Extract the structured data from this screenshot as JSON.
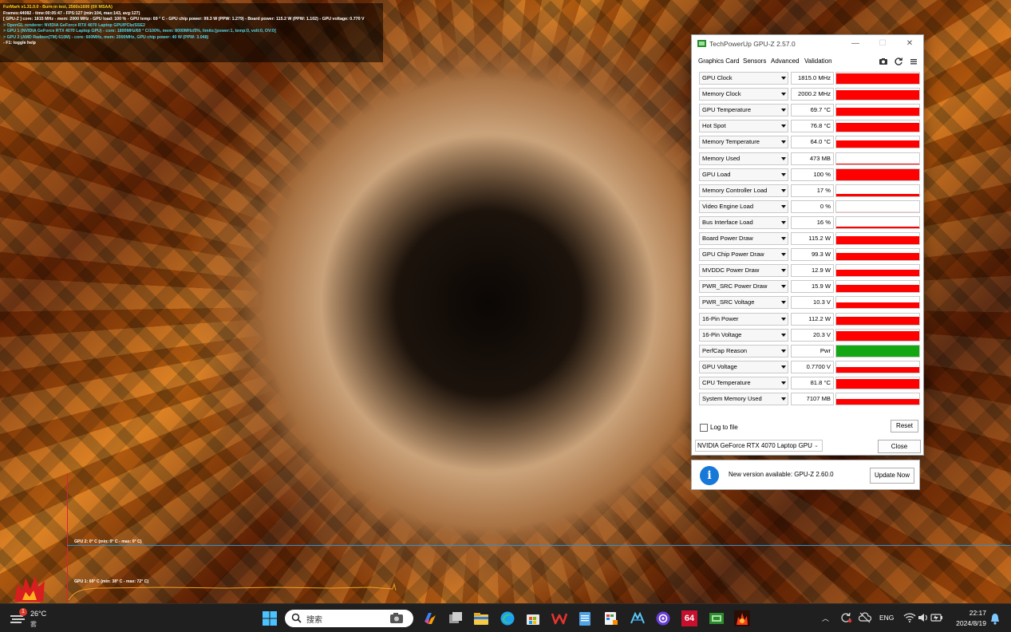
{
  "furmark": {
    "lines": [
      {
        "text": "FurMark v1.31.0.0 - Burn-in test, 2560x1600 (0X MSAA)",
        "tone": "yellow"
      },
      {
        "text": "Frames:44082 - time:00:05:47 - FPS:127 (min:104, max:143, avg:127)",
        "tone": "white"
      },
      {
        "text": "[ GPU-Z ] core: 1815 MHz - mem: 2000 MHz - GPU load: 100 % - GPU temp: 69 ° C - GPU chip power: 99.3 W (PPW: 1.279) - Board power: 115.2 W (PPW: 1.102) - GPU voltage: 0.770 V",
        "tone": "white"
      },
      {
        "text": "> OpenGL renderer: NVIDIA GeForce RTX 4070 Laptop GPU/PCIe/SSE2",
        "tone": "cyan"
      },
      {
        "text": "> GPU 1 (NVIDIA GeForce RTX 4070 Laptop GPU) - core: 1800MHz/69 ° C/100%, mem: 8000MHz/5%, limits:[power:1, temp:0, volt:0, OV:0]",
        "tone": "cyan"
      },
      {
        "text": "> GPU 2 (AMD Radeon(TM) 610M) - core: 600MHz, mem: 2000MHz, GPU chip power: 40 W (PPW: 3.048)",
        "tone": "cyan"
      },
      {
        "text": "- F1: toggle help",
        "tone": "white"
      }
    ],
    "graph_gpu2_label": "GPU 2: 0° C (min: 0° C - max: 0° C)",
    "graph_gpu1_label": "GPU 1: 69° C (min: 38° C - max: 72° C)"
  },
  "gpuz": {
    "title": "TechPowerUp GPU-Z 2.57.0",
    "window_controls": {
      "minimize": "—",
      "maximize": "☐",
      "close": "✕"
    },
    "tabs": [
      {
        "label": "Graphics Card",
        "active": false
      },
      {
        "label": "Sensors",
        "active": true
      },
      {
        "label": "Advanced",
        "active": false
      },
      {
        "label": "Validation",
        "active": false
      }
    ],
    "toolbar_icons": [
      "camera-icon",
      "refresh-icon",
      "menu-icon"
    ],
    "sensors": [
      {
        "name": "GPU Clock",
        "value": "1815.0 MHz",
        "level": 0.92,
        "color": "#ff0000"
      },
      {
        "name": "Memory Clock",
        "value": "2000.2 MHz",
        "level": 0.9,
        "color": "#ff0000"
      },
      {
        "name": "GPU Temperature",
        "value": "69.7 °C",
        "level": 0.72,
        "color": "#ff0000"
      },
      {
        "name": "Hot Spot",
        "value": "76.8 °C",
        "level": 0.78,
        "color": "#ff0000"
      },
      {
        "name": "Memory Temperature",
        "value": "64.0 °C",
        "level": 0.68,
        "color": "#ff0000"
      },
      {
        "name": "Memory Used",
        "value": "473 MB",
        "level": 0.06,
        "color": "#ff0000"
      },
      {
        "name": "GPU Load",
        "value": "100 %",
        "level": 0.95,
        "color": "#ff0000"
      },
      {
        "name": "Memory Controller Load",
        "value": "17 %",
        "level": 0.17,
        "color": "#ff0000"
      },
      {
        "name": "Video Engine Load",
        "value": "0 %",
        "level": 0.0,
        "color": "#ff0000"
      },
      {
        "name": "Bus Interface Load",
        "value": "16 %",
        "level": 0.16,
        "color": "#ff0000"
      },
      {
        "name": "Board Power Draw",
        "value": "115.2 W",
        "level": 0.72,
        "color": "#ff0000"
      },
      {
        "name": "GPU Chip Power Draw",
        "value": "99.3 W",
        "level": 0.66,
        "color": "#ff0000"
      },
      {
        "name": "MVDDC Power Draw",
        "value": "12.9 W",
        "level": 0.6,
        "color": "#ff0000"
      },
      {
        "name": "PWR_SRC Power Draw",
        "value": "15.9 W",
        "level": 0.65,
        "color": "#ff0000"
      },
      {
        "name": "PWR_SRC Voltage",
        "value": "10.3 V",
        "level": 0.55,
        "color": "#ff0000"
      },
      {
        "name": "16-Pin Power",
        "value": "112.2 W",
        "level": 0.7,
        "color": "#ff0000"
      },
      {
        "name": "16-Pin Voltage",
        "value": "20.3 V",
        "level": 0.8,
        "color": "#ff0000"
      },
      {
        "name": "PerfCap Reason",
        "value": "Pwr",
        "level": 1.0,
        "color": "#13a813"
      },
      {
        "name": "GPU Voltage",
        "value": "0.7700 V",
        "level": 0.5,
        "color": "#ff0000"
      },
      {
        "name": "CPU Temperature",
        "value": "81.8 °C",
        "level": 0.82,
        "color": "#ff0000"
      },
      {
        "name": "System Memory Used",
        "value": "7107 MB",
        "level": 0.48,
        "color": "#ff0000"
      }
    ],
    "log_to_file_label": "Log to file",
    "log_to_file_checked": false,
    "reset_label": "Reset",
    "gpu_select_value": "NVIDIA GeForce RTX 4070 Laptop GPU",
    "close_label": "Close"
  },
  "update_bar": {
    "text": "New version available: GPU-Z 2.60.0",
    "button_label": "Update Now"
  },
  "taskbar": {
    "weather": {
      "temp": "26°C",
      "desc": "雾",
      "badge": "1"
    },
    "search_placeholder": "搜索",
    "apps": [
      "copilot-icon",
      "task-view-icon",
      "file-explorer-icon",
      "edge-icon",
      "store-icon",
      "wps-icon",
      "notepad-icon",
      "paint-icon",
      "xmind-icon",
      "vpn-icon",
      "aida64-icon",
      "gpuz-taskbar-icon",
      "furmark-taskbar-icon"
    ],
    "aida_label": "64",
    "lang": "ENG",
    "time": "22:17",
    "date": "2024/8/19"
  }
}
